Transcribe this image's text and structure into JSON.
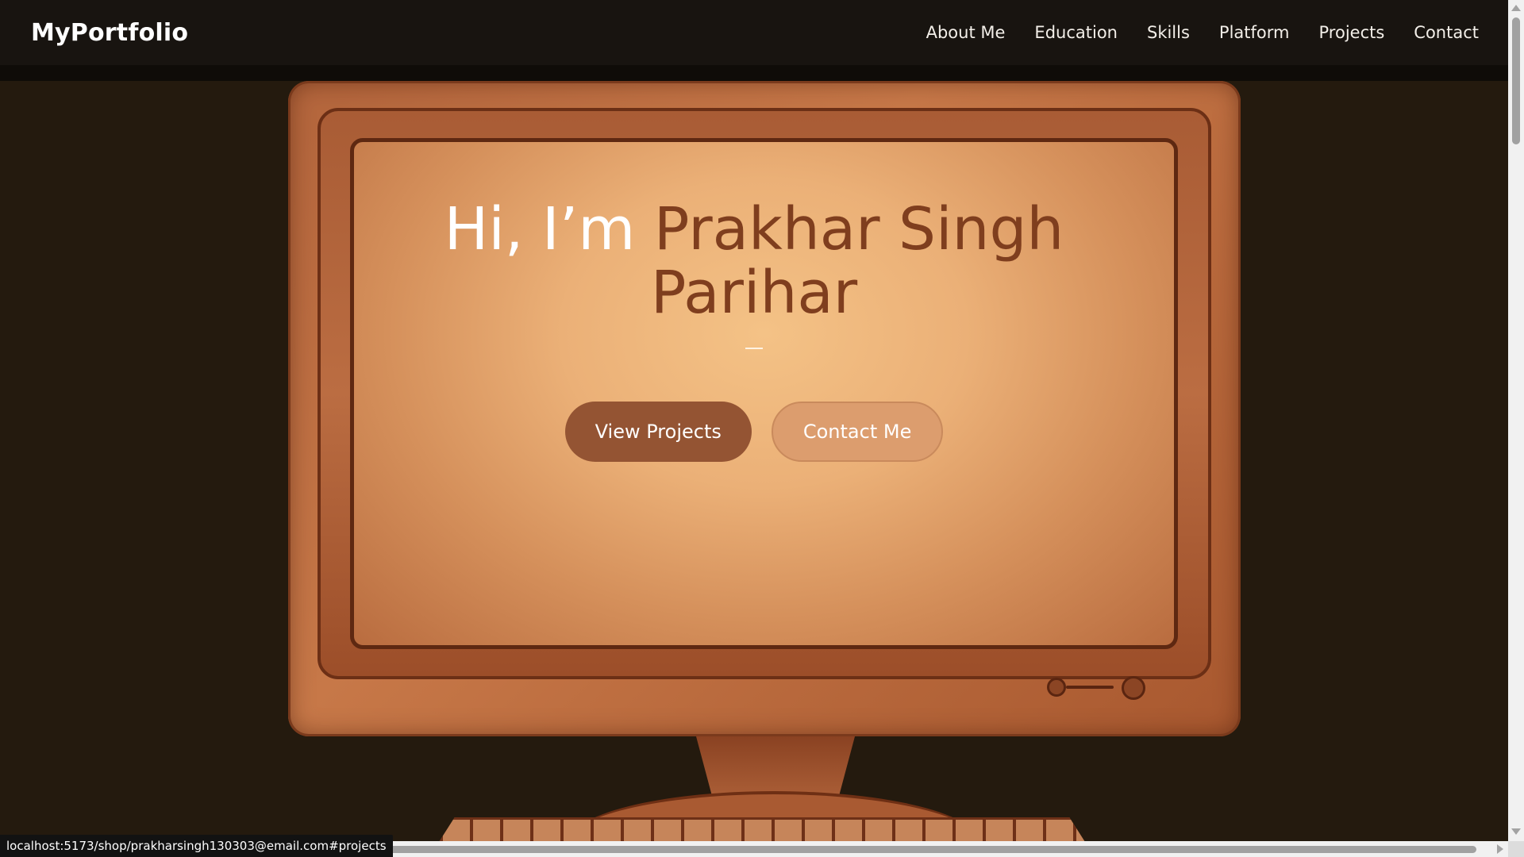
{
  "navbar": {
    "brand": "MyPortfolio",
    "links": [
      {
        "label": "About Me"
      },
      {
        "label": "Education"
      },
      {
        "label": "Skills"
      },
      {
        "label": "Platform"
      },
      {
        "label": "Projects"
      },
      {
        "label": "Contact"
      }
    ]
  },
  "hero": {
    "greeting": "Hi, I’m ",
    "name": "Prakhar Singh Parihar",
    "buttons": {
      "primary": "View Projects",
      "secondary": "Contact Me"
    }
  },
  "status_bar": {
    "url": "localhost:5173/shop/prakharsingh130303@email.com#projects"
  },
  "colors": {
    "page_background": "#241a0e",
    "navbar_background": "#181410",
    "name_accent": "#7f3e1e",
    "primary_button": "#945433",
    "secondary_button": "#dc9d6e"
  }
}
